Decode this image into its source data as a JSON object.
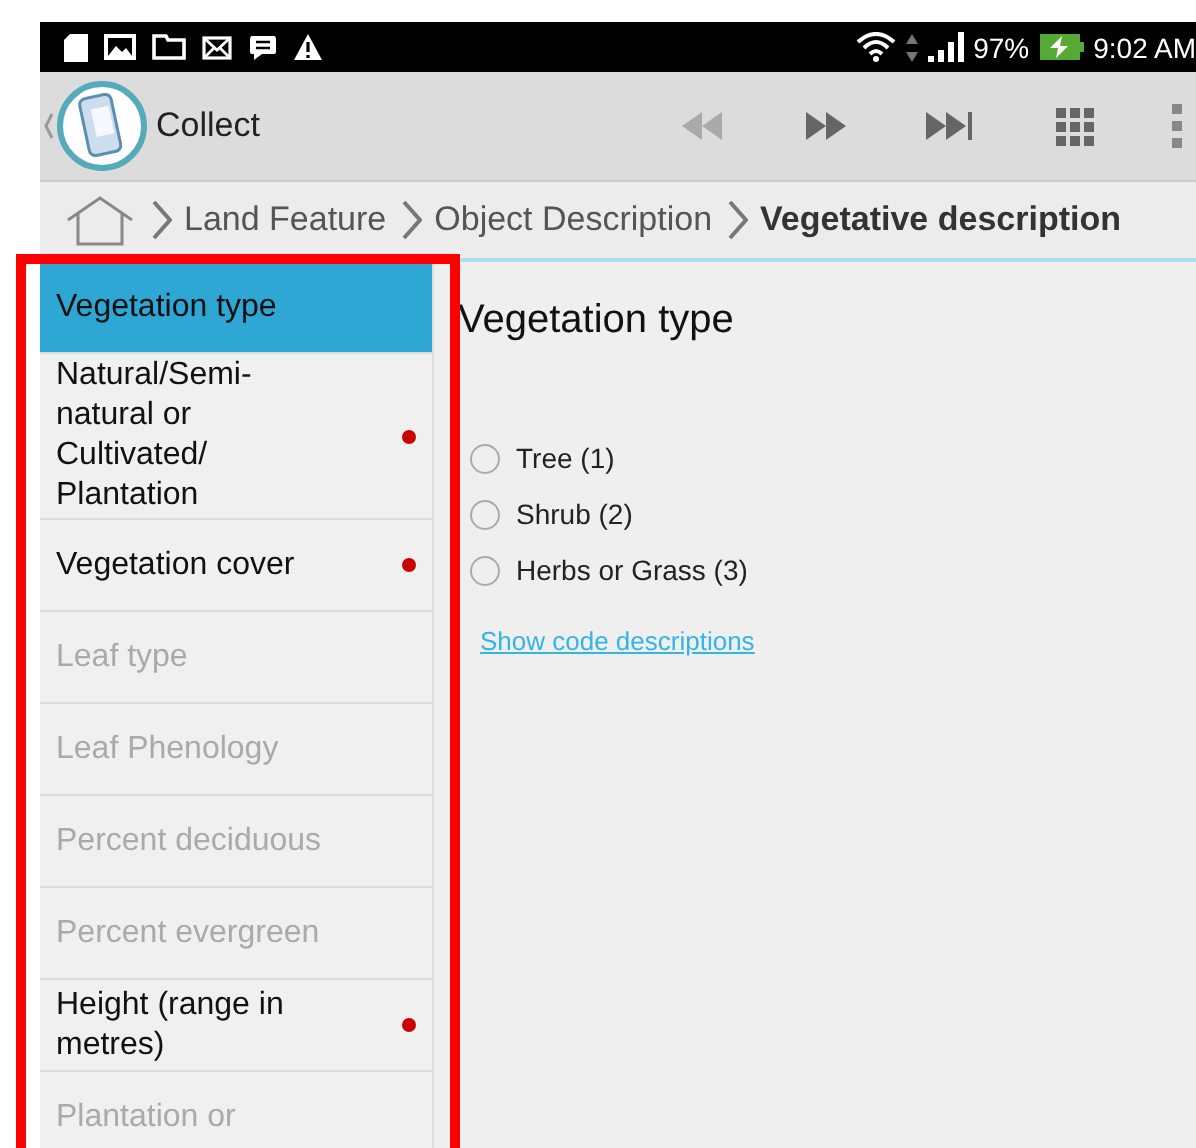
{
  "status_bar": {
    "battery": "97%",
    "time": "9:02 AM"
  },
  "action_bar": {
    "title": "Collect"
  },
  "breadcrumb": [
    {
      "label": "Land Feature",
      "current": false
    },
    {
      "label": "Object Description",
      "current": false
    },
    {
      "label": "Vegetative description",
      "current": true
    }
  ],
  "sidebar": {
    "items": [
      {
        "label": "Vegetation type",
        "selected": true,
        "required": false,
        "enabled": true
      },
      {
        "label": "Natural/Semi-natural or Cultivated/ Plantation",
        "selected": false,
        "required": true,
        "enabled": true
      },
      {
        "label": "Vegetation cover",
        "selected": false,
        "required": true,
        "enabled": true
      },
      {
        "label": "Leaf type",
        "selected": false,
        "required": false,
        "enabled": false
      },
      {
        "label": "Leaf Phenology",
        "selected": false,
        "required": false,
        "enabled": false
      },
      {
        "label": "Percent deciduous",
        "selected": false,
        "required": false,
        "enabled": false
      },
      {
        "label": "Percent evergreen",
        "selected": false,
        "required": false,
        "enabled": false
      },
      {
        "label": "Height (range in metres)",
        "selected": false,
        "required": true,
        "enabled": true
      },
      {
        "label": "Plantation or",
        "selected": false,
        "required": false,
        "enabled": false
      }
    ]
  },
  "content": {
    "title": "Vegetation type",
    "options": [
      {
        "label": "Tree (1)",
        "checked": false
      },
      {
        "label": "Shrub (2)",
        "checked": false
      },
      {
        "label": "Herbs or Grass (3)",
        "checked": false
      }
    ],
    "link": "Show code descriptions"
  }
}
